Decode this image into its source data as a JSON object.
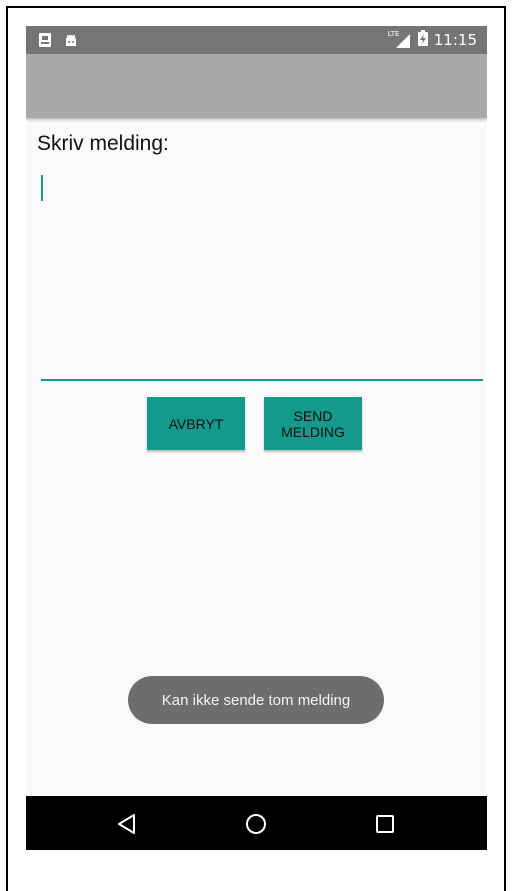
{
  "status_bar": {
    "time": "11:15",
    "network": "LTE",
    "icons": [
      "sim-card-icon",
      "android-icon",
      "signal-icon",
      "battery-charging-icon"
    ]
  },
  "compose": {
    "label": "Skriv melding:",
    "message_value": ""
  },
  "buttons": {
    "cancel_label": "AVBRYT",
    "send_label": "SEND\nMELDING"
  },
  "toast": {
    "text": "Kan ikke sende tom melding"
  },
  "navigation": {
    "icons": [
      "back-icon",
      "home-icon",
      "recent-apps-icon"
    ]
  },
  "colors": {
    "accent": "#139a8a",
    "toolbar": "#a9a9a9",
    "status_bar": "#757575"
  }
}
